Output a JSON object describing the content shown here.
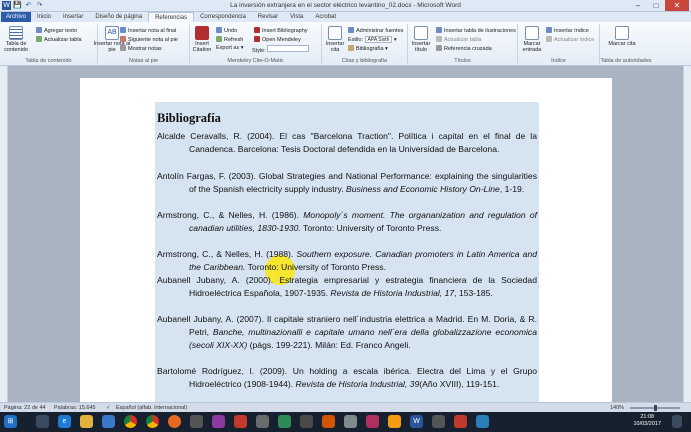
{
  "window": {
    "title": "La inversión extranjera en el sector eléctrico levantino_02.docx - Microsoft Word"
  },
  "tabs": [
    "Archivo",
    "Inicio",
    "Insertar",
    "Diseño de página",
    "Referencias",
    "Correspondencia",
    "Revisar",
    "Vista",
    "Acrobat"
  ],
  "ribbon": {
    "toc": {
      "big": "Tabla de contenido",
      "add_text": "Agregar texto",
      "update_table": "Actualizar tabla",
      "label": "Tabla de contenido"
    },
    "footnotes": {
      "big": "Insertar nota al pie",
      "insert_endnote": "Insertar nota al final",
      "next_footnote": "Siguiente nota al pie",
      "show_notes": "Mostrar notas",
      "label": "Notas al pie"
    },
    "mendeley": {
      "insert_citation": "Insert Citation",
      "undo": "Undo",
      "refresh": "Refresh",
      "export": "Export as",
      "insert_bibliography": "Insert Bibliography",
      "open_mendeley": "Open Mendeley",
      "style_label": "Style:",
      "style_value": "",
      "label": "Mendeley Cite-O-Matic"
    },
    "citations": {
      "big": "Insertar cita",
      "manage_sources": "Administrar fuentes",
      "style_label": "Estilo:",
      "style_value": "APA Sixth",
      "bibliography": "Bibliografía",
      "label": "Citas y bibliografía"
    },
    "captions": {
      "big": "Insertar título",
      "insert_table_of_figures": "Insertar tabla de ilustraciones",
      "update_table": "Actualizar tabla",
      "cross_reference": "Referencia cruzada",
      "label": "Títulos"
    },
    "index": {
      "big": "Marcar entrada",
      "insert_index": "Insertar índice",
      "update_index": "Actualizar índice",
      "label": "Índice"
    },
    "authorities": {
      "big": "Marcar cita",
      "label": "Tabla de autoridades"
    }
  },
  "document": {
    "heading": "Bibliografía",
    "references": [
      {
        "pre": "Alcalde Ceravalls, R. (2004). El cas \"Barcelona Traction\". Política i capital en el final de la Canadenca. Barcelona: Tesis Doctoral defendida en la Universidad de Barcelona.",
        "ital": "",
        "post": ""
      },
      {
        "pre": "Antolín Fargas, F. (2003). Global Strategies and National Performance: explaining the singularities of the Spanish electricity supply industry. ",
        "ital": "Business and Economic History On-Line",
        "post": ", 1-19."
      },
      {
        "pre": "Armstrong, C., & Nelles, H. (1986). ",
        "ital": "Monopoly´s moment. The organanization and regulation of canadian utilities, 1830-1930.",
        "post": " Toronto: University of Toronto Press."
      },
      {
        "pre": "Armstrong, C., & Nelles, H. (1988). ",
        "ital": "Southern exposure. Canadian promoters in Latin America and the Caribbean.",
        "post": " Toronto: University of Toronto Press."
      },
      {
        "pre": "Aubanell Jubany, A. (2000). Estrategia empresarial y estrategia financiera de la Sociedad Hidroeléctrica Española, 1907-1935. ",
        "ital": "Revista de Historia Industrial, 17",
        "post": ", 153-185."
      },
      {
        "pre": "Aubanell Jubany, A. (2007). Il capitale straniero nell´industria elettrica a Madrid. En M. Doria, & R. Petri, ",
        "ital": "Banche, multinazionalli e capitale umano nell´era della globalizzazione economica (secoli XIX-XX)",
        "post": " (págs. 199-221). Milán: Ed. Franco Angeli."
      },
      {
        "pre": "Bartolomé Rodríguez, I. (2009). Un holding a escala ibérica. Electra del Lima y el Grupo Hidroeléctrico (1908-1944). ",
        "ital": "Revista de Historia Industrial, 39",
        "post": "(Año XVIII), 119-151."
      }
    ]
  },
  "status": {
    "page": "Página: 22 de 44",
    "words": "Palabras: 15.645",
    "language": "Español (alfab. internacional)",
    "zoom": "140%"
  },
  "taskbar": {
    "time": "21:08",
    "date": "10/03/2017"
  }
}
